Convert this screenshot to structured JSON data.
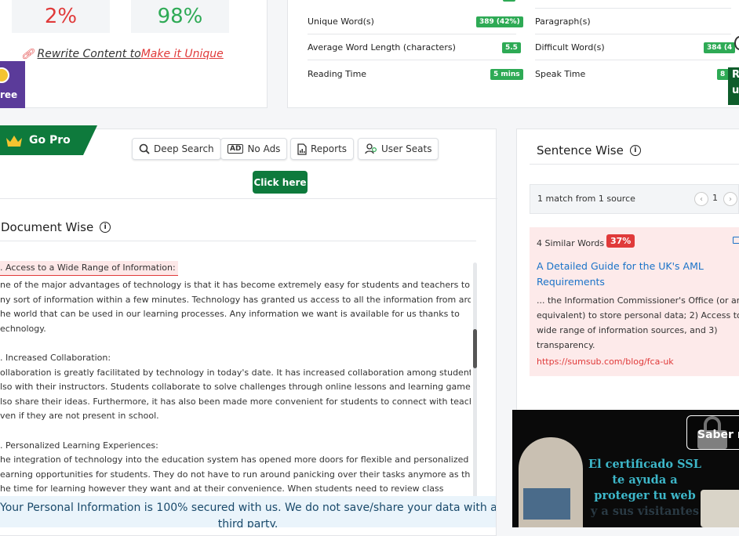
{
  "scores": {
    "plagiarism": "2%",
    "unique": "98%"
  },
  "rewrite": {
    "prefix": "Rewrite Content to ",
    "link": "Make it Unique"
  },
  "free_badge": "ree",
  "stats": {
    "unique_words_label": "Unique Word(s)",
    "unique_words_value": "389 (42%)",
    "avg_word_label": "Average Word Length (characters)",
    "avg_word_value": "5.5",
    "reading_time_label": "Reading Time",
    "reading_time_value": "5 mins",
    "paragraph_label": "Paragraph(s)",
    "difficult_label": "Difficult Word(s)",
    "difficult_value": "384 (4",
    "speak_label": "Speak Time",
    "speak_value": "8 r"
  },
  "right_edge": {
    "top": "R",
    "bottom": "u"
  },
  "go_pro": "Go Pro",
  "features": [
    "Deep Search",
    "No Ads",
    "Reports",
    "User Seats"
  ],
  "click_here": "Click here",
  "document_wise": "Document Wise",
  "doc_paragraphs": [
    {
      "heading": ". Access to a Wide Range of Information:",
      "lines": [
        "ne of the major advantages of technology is that it has become extremely easy for students and teachers to gather",
        "ny sort of information within a few minutes. Technology has granted us access to all the information from around",
        "he world that can be used in our learning processes. Any information we want is available for us thanks to",
        "echnology."
      ]
    },
    {
      "heading": ". Increased Collaboration:",
      "lines": [
        "ollaboration is greatly facilitated by technology in today's date. It has increased collaboration among students and",
        "lso with their instructors. Students collaborate to solve challenges through online lessons and learning games and",
        "lso share their ideas. Furthermore, it has also been made more convenient for students to connect with teachers",
        "ven if they are not present in school."
      ]
    },
    {
      "heading": ". Personalized Learning Experiences:",
      "lines": [
        "he integration of technology into the education system has opened more doors for flexible and personalized",
        "earning opportunities for students. They do not have to run around panicking over their tasks anymore as they plan",
        "he time for learning however they want and at their convenience. When students need to review class"
      ]
    }
  ],
  "privacy": {
    "line1": "Your Personal Information is 100% secured with us. We do not save/share your data with any",
    "line2": "third party."
  },
  "sentence_wise": "Sentence Wise",
  "match_info": "1 match from 1 source",
  "pager_page": "1",
  "result": {
    "similar_label": "4 Similar Words",
    "percent": "37%",
    "title_line1": "A Detailed Guide for the UK's AML",
    "title_line2": "Requirements",
    "snippet": [
      "... the Information Commissioner's Office (or an",
      "equivalent) to store personal data; 2) Access to a",
      "wide range of information sources, and 3)",
      "transparency."
    ],
    "url": "https://sumsub.com/blog/fca-uk"
  },
  "ad": {
    "line1": "El certificado SSL",
    "line2": "te ayuda a",
    "line3": "proteger tu web",
    "line4": "y a sus visitantes",
    "button": "Saber m"
  },
  "colors": {
    "green": "#2eaa55",
    "red": "#e03a3a",
    "dark_green": "#0e7a3c",
    "purple": "#5b3b9a"
  }
}
